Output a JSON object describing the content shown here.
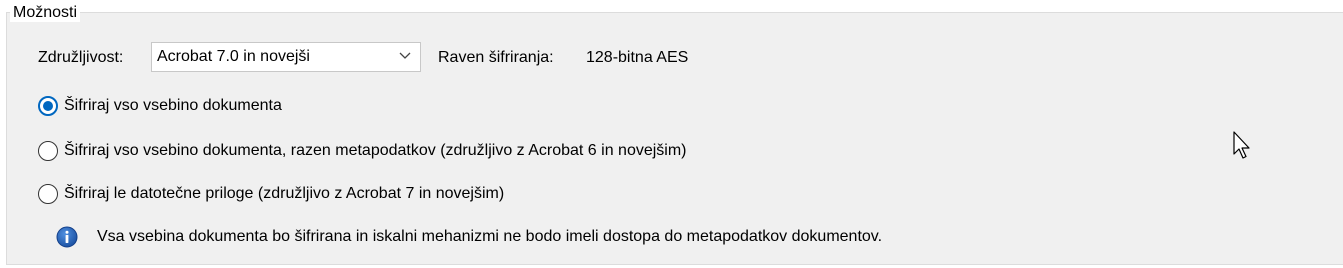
{
  "options_group": {
    "title": "Možnosti"
  },
  "compatibility": {
    "label": "Združljivost:",
    "selected": "Acrobat 7.0 in novejši"
  },
  "encryption_level": {
    "label": "Raven šifriranja:",
    "value": "128-bitna AES"
  },
  "radio_options": [
    {
      "label": "Šifriraj vso vsebino dokumenta",
      "checked": true
    },
    {
      "label": "Šifriraj vso vsebino dokumenta, razen metapodatkov (združljivo z Acrobat 6 in novejšim)",
      "checked": false
    },
    {
      "label": "Šifriraj le datotečne priloge (združljivo z Acrobat 7 in novejšim)",
      "checked": false
    }
  ],
  "info": {
    "icon": "info-icon",
    "text": "Vsa vsebina dokumenta bo šifrirana in iskalni mehanizmi ne bodo imeli dostopa do metapodatkov dokumentov."
  },
  "colors": {
    "accent": "#0067c0",
    "panel_bg": "#f0f0f0",
    "info_icon": "#1f5fb4"
  }
}
